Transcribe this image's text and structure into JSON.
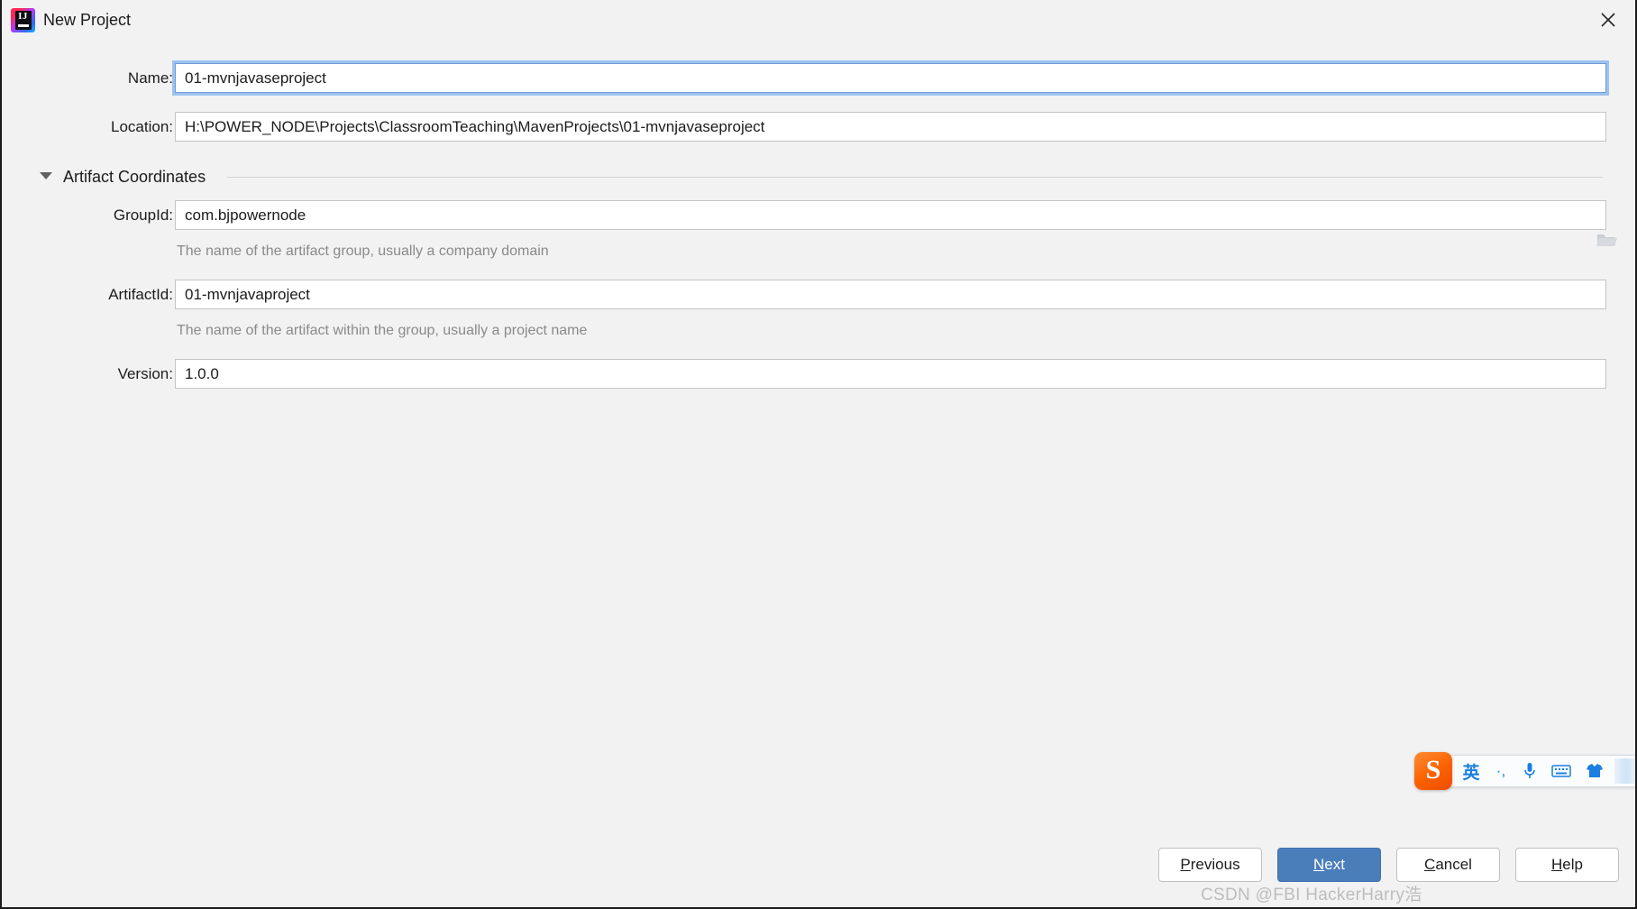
{
  "window": {
    "title": "New Project",
    "app_icon": "intellij-idea-logo",
    "app_icon_letters": "IJ",
    "close_icon": "close-icon"
  },
  "form": {
    "name": {
      "label": "Name:",
      "value": "01-mvnjavaseproject",
      "focused": true
    },
    "location": {
      "label": "Location:",
      "value": "H:\\POWER_NODE\\Projects\\ClassroomTeaching\\MavenProjects\\01-mvnjavaseproject",
      "browse_icon": "folder-icon"
    },
    "artifact_section": {
      "title": "Artifact Coordinates",
      "toggle_icon": "chevron-down-icon",
      "expanded": true
    },
    "group_id": {
      "label": "GroupId:",
      "value": "com.bjpowernode",
      "hint": "The name of the artifact group, usually a company domain"
    },
    "artifact_id": {
      "label": "ArtifactId:",
      "value": "01-mvnjavaproject",
      "hint": "The name of the artifact within the group, usually a project name"
    },
    "version": {
      "label": "Version:",
      "value": "1.0.0"
    }
  },
  "buttons": {
    "previous": {
      "label": "Previous",
      "mnemonic": "P",
      "rest": "revious"
    },
    "next": {
      "label": "Next",
      "mnemonic": "N",
      "rest": "ext",
      "primary": true
    },
    "cancel": {
      "label": "Cancel",
      "mnemonic": "C",
      "rest": "ancel"
    },
    "help": {
      "label": "Help",
      "mnemonic": "H",
      "rest": "elp"
    }
  },
  "ime_toolbar": {
    "logo": "sogou-logo",
    "logo_letter": "S",
    "language_mode": "英",
    "punctuation_icon": "punctuation-icon",
    "punctuation_label": "·,",
    "microphone_icon": "microphone-icon",
    "keyboard_icon": "keyboard-icon",
    "skin_icon": "tshirt-skin-icon"
  },
  "watermark": {
    "text": "CSDN @FBI HackerHarry浩"
  },
  "colors": {
    "dialog_background": "#f2f2f2",
    "primary_button": "#4a7ebb",
    "focus_ring": "#9cc2ee",
    "hint_text": "#8a8a8a",
    "ime_accent": "#1a7fe0",
    "ime_logo": "#fa6000"
  }
}
